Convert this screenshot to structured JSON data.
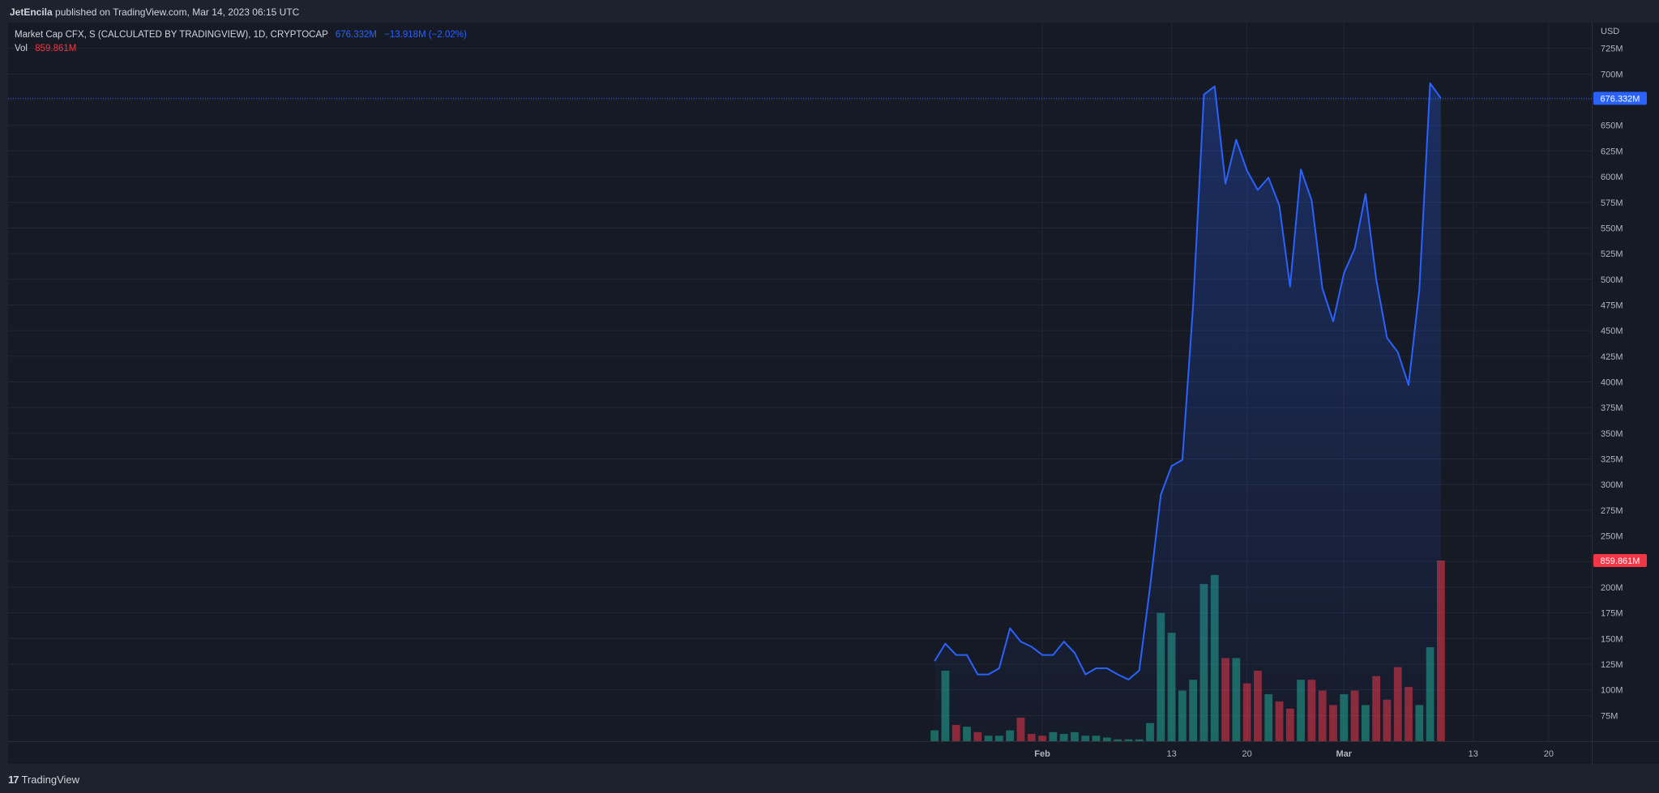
{
  "header": {
    "author": "JetEncila",
    "published_text": "published on TradingView.com, Mar 14, 2023 06:15 UTC"
  },
  "legend": {
    "series_title": "Market Cap CFX, S (CALCULATED BY TRADINGVIEW), 1D, CRYPTOCAP",
    "last_value": "676.332M",
    "change": "−13.918M (−2.02%)",
    "vol_label": "Vol",
    "vol_value": "859.861M"
  },
  "footer": {
    "brand": "TradingView",
    "logo_text": "17"
  },
  "colors": {
    "line": "#2962ff",
    "volume_up": "#22ab94",
    "volume_down": "#f23645",
    "background": "#161a25"
  },
  "chart_data": {
    "type": "area",
    "currency": "USD",
    "ylim": [
      50,
      750
    ],
    "y_ticks": [
      75,
      100,
      125,
      150,
      175,
      200,
      225,
      250,
      275,
      300,
      325,
      350,
      375,
      400,
      425,
      450,
      475,
      500,
      525,
      550,
      575,
      600,
      625,
      650,
      675,
      700,
      725
    ],
    "y_tick_labels": [
      "75M",
      "100M",
      "125M",
      "150M",
      "175M",
      "200M",
      "225M",
      "250M",
      "275M",
      "300M",
      "325M",
      "350M",
      "375M",
      "400M",
      "425M",
      "450M",
      "475M",
      "500M",
      "525M",
      "550M",
      "575M",
      "600M",
      "625M",
      "650M",
      "675M",
      "700M",
      "725M"
    ],
    "hidden_tick_labels": [
      "225M",
      "675M"
    ],
    "x_ticks": [
      {
        "label": "Feb",
        "date": "2023-02-01"
      },
      {
        "label": "13",
        "date": "2023-02-13"
      },
      {
        "label": "20",
        "date": "2023-02-20"
      },
      {
        "label": "Mar",
        "date": "2023-03-01"
      },
      {
        "label": "13",
        "date": "2023-03-13"
      },
      {
        "label": "20",
        "date": "2023-03-20"
      }
    ],
    "x_range": [
      "2022-10-28",
      "2023-03-24"
    ],
    "last_price_label": "676.332M",
    "last_price": 676.332,
    "last_volume_label": "859.861M",
    "grid": true,
    "series": [
      {
        "name": "Market Cap CFX",
        "points": [
          [
            "2023-01-22",
            128
          ],
          [
            "2023-01-23",
            145
          ],
          [
            "2023-01-24",
            134
          ],
          [
            "2023-01-25",
            134
          ],
          [
            "2023-01-26",
            115
          ],
          [
            "2023-01-27",
            115
          ],
          [
            "2023-01-28",
            121
          ],
          [
            "2023-01-29",
            160
          ],
          [
            "2023-01-30",
            147
          ],
          [
            "2023-01-31",
            142
          ],
          [
            "2023-02-01",
            134
          ],
          [
            "2023-02-02",
            134
          ],
          [
            "2023-02-03",
            147
          ],
          [
            "2023-02-04",
            136
          ],
          [
            "2023-02-05",
            115
          ],
          [
            "2023-02-06",
            121
          ],
          [
            "2023-02-07",
            121
          ],
          [
            "2023-02-08",
            115
          ],
          [
            "2023-02-09",
            110
          ],
          [
            "2023-02-10",
            119
          ],
          [
            "2023-02-11",
            200
          ],
          [
            "2023-02-12",
            290
          ],
          [
            "2023-02-13",
            318
          ],
          [
            "2023-02-14",
            324
          ],
          [
            "2023-02-15",
            475
          ],
          [
            "2023-02-16",
            680
          ],
          [
            "2023-02-17",
            688
          ],
          [
            "2023-02-18",
            593
          ],
          [
            "2023-02-19",
            636
          ],
          [
            "2023-02-20",
            606
          ],
          [
            "2023-02-21",
            587
          ],
          [
            "2023-02-22",
            599
          ],
          [
            "2023-02-23",
            572
          ],
          [
            "2023-02-24",
            493
          ],
          [
            "2023-02-25",
            607
          ],
          [
            "2023-02-26",
            577
          ],
          [
            "2023-02-27",
            491
          ],
          [
            "2023-02-28",
            459
          ],
          [
            "2023-03-01",
            506
          ],
          [
            "2023-03-02",
            530
          ],
          [
            "2023-03-03",
            583
          ],
          [
            "2023-03-04",
            500
          ],
          [
            "2023-03-05",
            443
          ],
          [
            "2023-03-06",
            429
          ],
          [
            "2023-03-07",
            397
          ],
          [
            "2023-03-08",
            490
          ],
          [
            "2023-03-09",
            691
          ],
          [
            "2023-03-10",
            676.332
          ]
        ]
      },
      {
        "name": "Vol",
        "type": "bar",
        "relative_heights": [
          [
            0.06,
            "up"
          ],
          [
            0.39,
            "up"
          ],
          [
            0.09,
            "down"
          ],
          [
            0.08,
            "up"
          ],
          [
            0.05,
            "down"
          ],
          [
            0.03,
            "up"
          ],
          [
            0.03,
            "up"
          ],
          [
            0.06,
            "up"
          ],
          [
            0.13,
            "down"
          ],
          [
            0.04,
            "down"
          ],
          [
            0.03,
            "down"
          ],
          [
            0.05,
            "up"
          ],
          [
            0.04,
            "up"
          ],
          [
            0.05,
            "up"
          ],
          [
            0.03,
            "up"
          ],
          [
            0.03,
            "up"
          ],
          [
            0.02,
            "up"
          ],
          [
            0.01,
            "up"
          ],
          [
            0.01,
            "up"
          ],
          [
            0.01,
            "up"
          ],
          [
            0.1,
            "up"
          ],
          [
            0.71,
            "up"
          ],
          [
            0.6,
            "up"
          ],
          [
            0.28,
            "up"
          ],
          [
            0.34,
            "up"
          ],
          [
            0.87,
            "up"
          ],
          [
            0.92,
            "up"
          ],
          [
            0.46,
            "down"
          ],
          [
            0.46,
            "up"
          ],
          [
            0.32,
            "down"
          ],
          [
            0.39,
            "down"
          ],
          [
            0.26,
            "up"
          ],
          [
            0.22,
            "down"
          ],
          [
            0.18,
            "down"
          ],
          [
            0.34,
            "up"
          ],
          [
            0.34,
            "down"
          ],
          [
            0.28,
            "down"
          ],
          [
            0.2,
            "down"
          ],
          [
            0.26,
            "up"
          ],
          [
            0.28,
            "down"
          ],
          [
            0.2,
            "up"
          ],
          [
            0.36,
            "down"
          ],
          [
            0.23,
            "down"
          ],
          [
            0.41,
            "down"
          ],
          [
            0.3,
            "down"
          ],
          [
            0.2,
            "up"
          ],
          [
            0.52,
            "up"
          ],
          [
            1.0,
            "down"
          ]
        ]
      }
    ]
  }
}
